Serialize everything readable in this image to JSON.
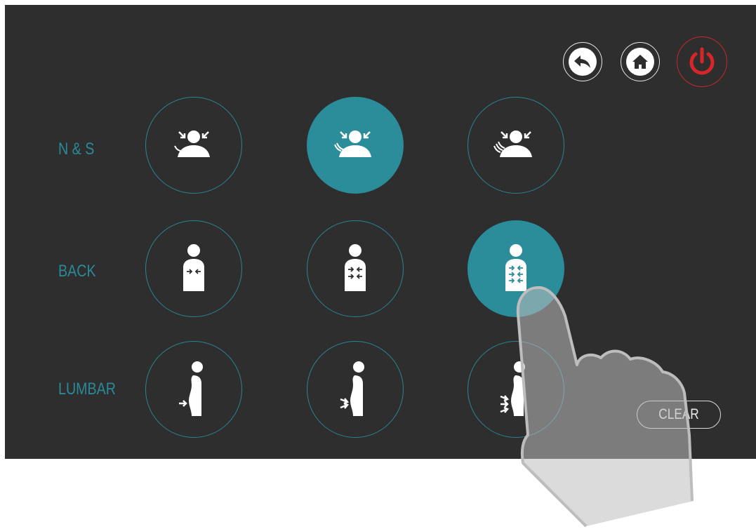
{
  "nav": {
    "back_icon": "back-arrow-icon",
    "home_icon": "home-icon",
    "power_icon": "power-icon",
    "power_color": "#d6262a"
  },
  "rows": [
    {
      "label": "N & S",
      "options": [
        {
          "icon": "neck-shoulder-level-1-icon",
          "active": false
        },
        {
          "icon": "neck-shoulder-level-2-icon",
          "active": true
        },
        {
          "icon": "neck-shoulder-level-3-icon",
          "active": false
        }
      ]
    },
    {
      "label": "BACK",
      "options": [
        {
          "icon": "back-level-1-icon",
          "active": false
        },
        {
          "icon": "back-level-2-icon",
          "active": false
        },
        {
          "icon": "back-level-3-icon",
          "active": true
        }
      ]
    },
    {
      "label": "LUMBAR",
      "options": [
        {
          "icon": "lumbar-level-1-icon",
          "active": false
        },
        {
          "icon": "lumbar-level-2-icon",
          "active": false
        },
        {
          "icon": "lumbar-level-3-icon",
          "active": false
        }
      ]
    }
  ],
  "clear_label": "CLEAR",
  "accent_color": "#2b8c9a",
  "background_color": "#2e2e2e"
}
